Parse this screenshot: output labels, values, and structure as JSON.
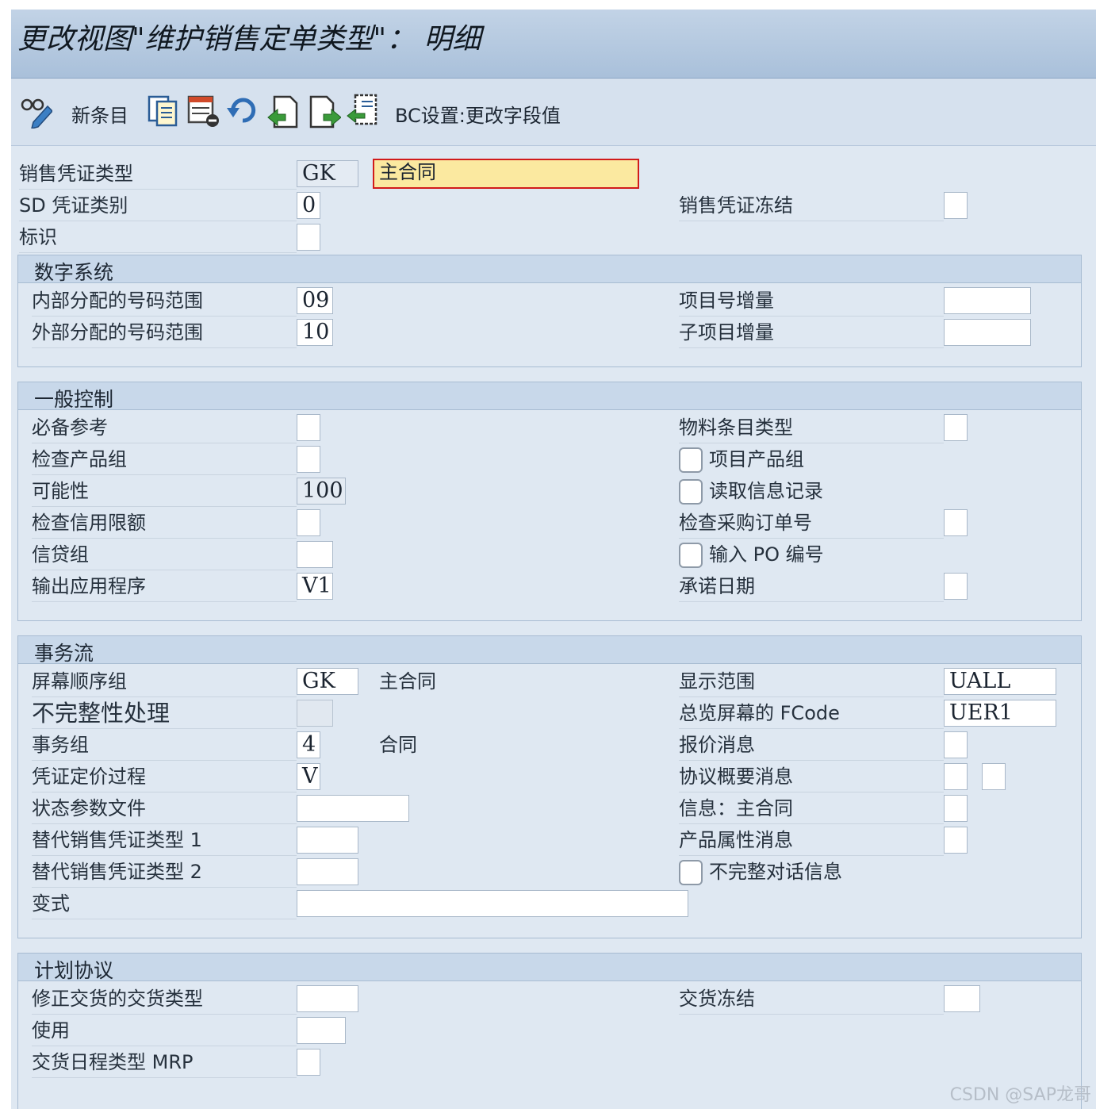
{
  "title": "更改视图\"维护销售定单类型\"： 明细",
  "toolbar": {
    "new_entries": "新条目",
    "bc_settings": "BC设置:更改字段值",
    "icons": [
      "glasses-pencil-icon",
      "copy-icon",
      "delete-icon",
      "undo-icon",
      "previous-entry-icon",
      "next-entry-icon",
      "transport-icon"
    ]
  },
  "header": {
    "doc_type_label": "销售凭证类型",
    "doc_type_value": "GK",
    "doc_type_desc": "主合同",
    "sd_category_label": "SD 凭证类别",
    "sd_category_value": "0",
    "block_label": "销售凭证冻结",
    "indicator_label": "标识"
  },
  "number_systems": {
    "title": "数字系统",
    "internal_label": "内部分配的号码范围",
    "internal_value": "09",
    "external_label": "外部分配的号码范围",
    "external_value": "10",
    "item_incr_label": "项目号增量",
    "subitem_incr_label": "子项目增量"
  },
  "general_control": {
    "title": "一般控制",
    "ref_mandatory": "必备参考",
    "check_div": "检查产品组",
    "probability": "可能性",
    "probability_value": "100",
    "check_credit": "检查信用限额",
    "credit_group": "信贷组",
    "output_app": "输出应用程序",
    "output_app_value": "V1",
    "material_entry_type": "物料条目类型",
    "item_division": "项目产品组",
    "read_info_record": "读取信息记录",
    "check_po": "检查采购订单号",
    "enter_po": "输入 PO 编号",
    "commit_date": "承诺日期"
  },
  "transaction_flow": {
    "title": "事务流",
    "screen_seq": "屏幕顺序组",
    "screen_seq_value": "GK",
    "screen_seq_desc": "主合同",
    "incompletion": "不完整性处理",
    "trans_group": "事务组",
    "trans_group_value": "4",
    "trans_group_desc": "合同",
    "pricing_proc": "凭证定价过程",
    "pricing_proc_value": "V",
    "status_profile": "状态参数文件",
    "alt_type1": "替代销售凭证类型 1",
    "alt_type2": "替代销售凭证类型 2",
    "variant": "变式",
    "display_range": "显示范围",
    "display_range_value": "UALL",
    "fcode": "总览屏幕的 FCode",
    "fcode_value": "UER1",
    "quotation_msg": "报价消息",
    "outline_msg": "协议概要消息",
    "info_msg": "信息：主合同",
    "product_attr_msg": "产品属性消息",
    "incomplete_dialog": "不完整对话信息"
  },
  "scheduling": {
    "title": "计划协议",
    "corr_delivery_type": "修正交货的交货类型",
    "usage": "使用",
    "mrp_type": "交货日程类型 MRP",
    "delivery_block": "交货冻结"
  },
  "watermark": "CSDN @SAP龙哥"
}
